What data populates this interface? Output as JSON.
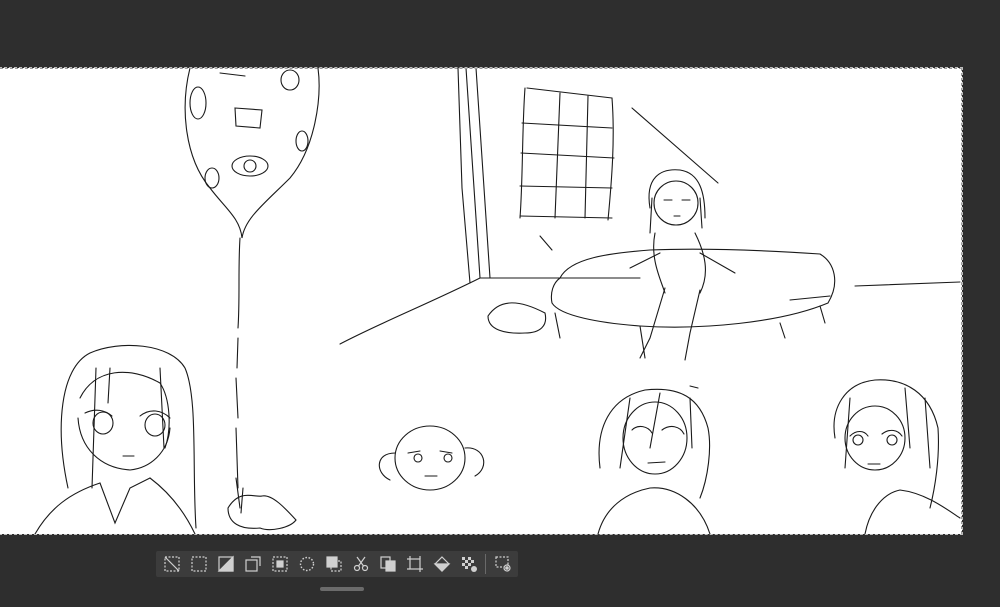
{
  "app": {
    "mode": "selection-launcher"
  },
  "canvas": {
    "background": "#ffffff",
    "stroke_color": "#1a1a1a",
    "workspace_color": "#2e2e2e"
  },
  "toolbar": {
    "background": "#3c3c3c",
    "icon_color": "#d0d0d0",
    "tools": [
      {
        "icon": "deselect-icon"
      },
      {
        "icon": "marquee-select-icon"
      },
      {
        "icon": "invert-selection-icon"
      },
      {
        "icon": "expand-selection-icon"
      },
      {
        "icon": "shrink-selection-icon"
      },
      {
        "icon": "soften-edge-icon"
      },
      {
        "icon": "selection-to-layer-icon"
      },
      {
        "icon": "cut-icon"
      },
      {
        "icon": "copy-paste-icon"
      },
      {
        "icon": "transform-icon"
      },
      {
        "icon": "fill-icon"
      },
      {
        "icon": "clear-transparent-icon"
      },
      {
        "icon": "selection-settings-icon"
      }
    ]
  }
}
